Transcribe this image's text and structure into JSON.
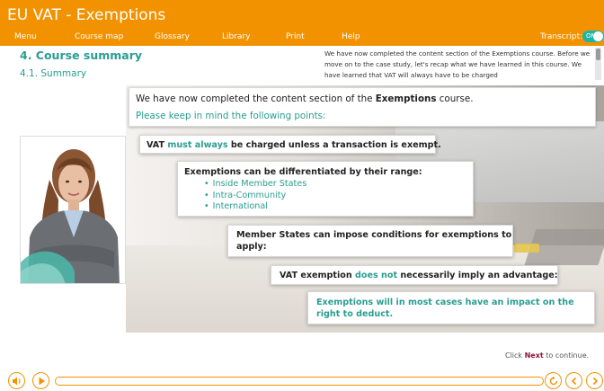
{
  "app": {
    "title": "EU VAT - Exemptions"
  },
  "menu": [
    "Menu",
    "Course map",
    "Glossary",
    "Library",
    "Print",
    "Help"
  ],
  "transcript": {
    "label": "Transcript:",
    "toggle": "ON",
    "text": "We have now completed the content section of the Exemptions course. Before we move on to the case study, let's recap what we have learned in this course. We have learned that VAT will always have to be charged"
  },
  "page": {
    "course_title": "4. Course summary",
    "section_title": "4.1. Summary"
  },
  "intro": {
    "line1_before": "We have now completed the content section of the ",
    "line1_bold": "Exemptions",
    "line1_after": " course.",
    "line2": "Please keep in mind the following points:"
  },
  "cards": {
    "c1_before": "VAT ",
    "c1_highlight": "must always",
    "c1_after": " be charged unless a transaction is exempt.",
    "c2_title": "Exemptions can be differentiated by their range:",
    "c2_items": [
      "Inside Member States",
      "Intra-Community",
      "International"
    ],
    "c3": "Member States can impose conditions for exemptions to apply:",
    "c4_before": "VAT exemption ",
    "c4_highlight": "does not",
    "c4_after": " necessarily imply an advantage:",
    "c5": "Exemptions will in most cases have an impact on the right to deduct."
  },
  "footer": {
    "continue_before": "Click ",
    "continue_bold": "Next",
    "continue_after": " to continue."
  },
  "colors": {
    "brand_orange": "#f39200",
    "accent_teal": "#2a9d91",
    "next_maroon": "#8b1538"
  },
  "icons": [
    "volume-icon",
    "play-icon",
    "replay-icon",
    "previous-icon",
    "next-icon"
  ]
}
